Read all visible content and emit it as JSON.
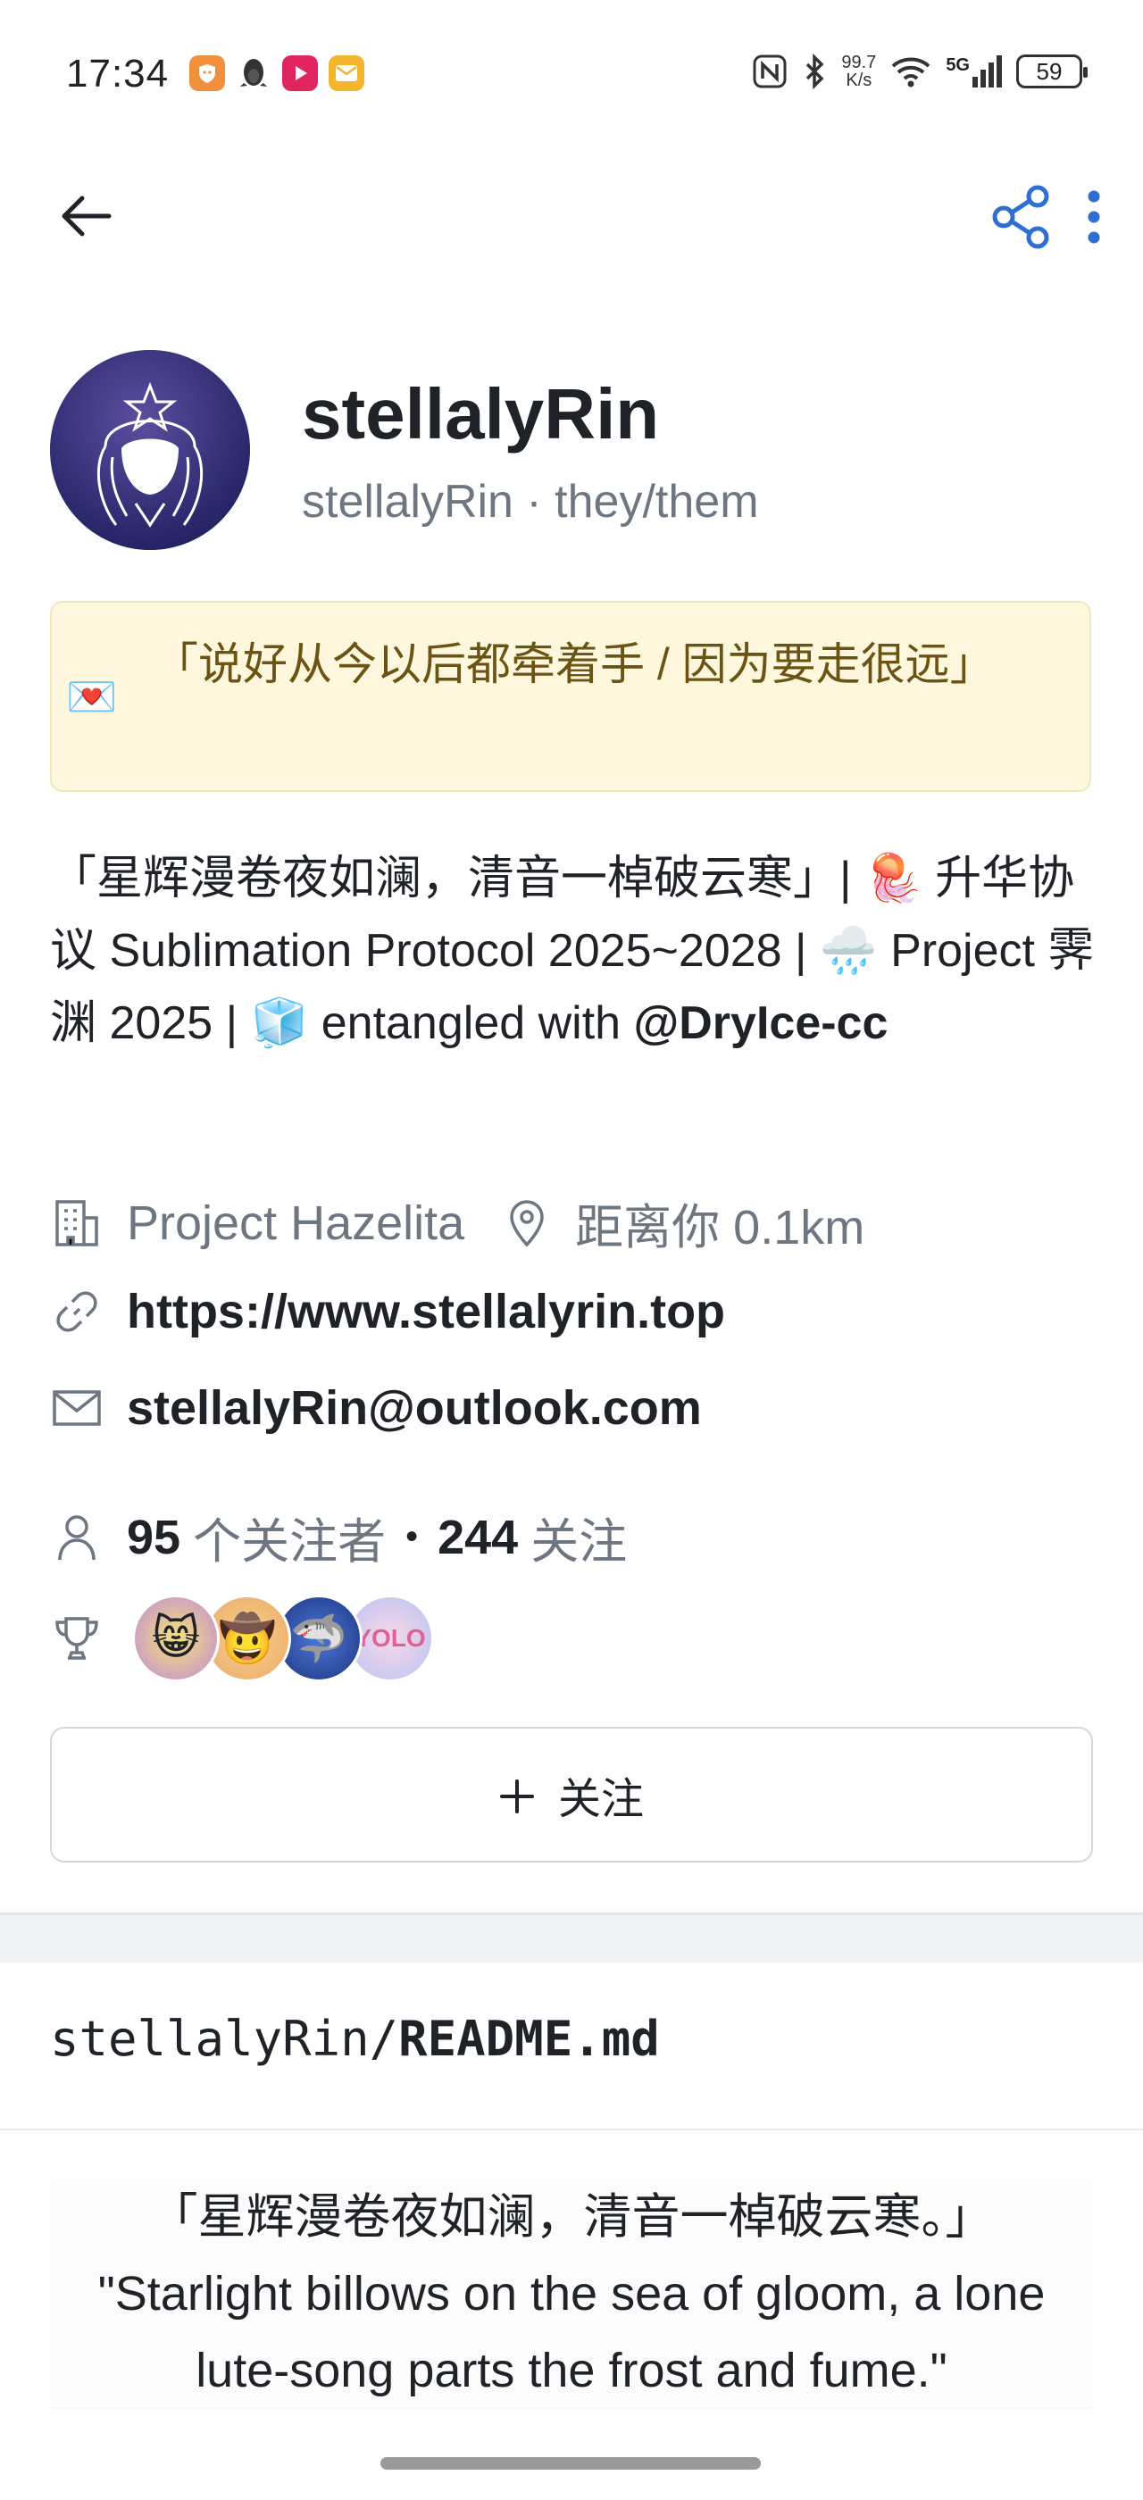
{
  "status_bar": {
    "time": "17:34",
    "net_speed_value": "99.7",
    "net_speed_unit": "K/s",
    "signal": "5G",
    "battery": "59"
  },
  "top_bar": {
    "back_icon": "arrow-left-icon",
    "share_icon": "share-icon",
    "more_icon": "kebab-menu-icon",
    "accent_color": "#2f6fd1"
  },
  "profile": {
    "display_name": "stellalyRin",
    "handle_line": "stellalyRin · they/them",
    "status": {
      "emoji": "💌",
      "text": "「说好从今以后都牵着手 / 因为要走很远」"
    },
    "bio": "「星辉漫卷夜如澜，清音一棹破云寒」| 🪼 升华协议 Sublimation Protocol 2025~2028 | 🌧️ Project 霁渊 2025 | 🧊 entangled with ",
    "bio_mention": "@DryIce-cc",
    "company": "Project Hazelita",
    "location": "距离你 0.1km",
    "website": "https://www.stellalyrin.top",
    "email": "stellalyRin@outlook.com",
    "followers_count": "95",
    "followers_label": "个关注者",
    "separator": "•",
    "following_count": "244",
    "following_label": "关注",
    "achievements": [
      "😸",
      "🤠",
      "🦈",
      "YOLO"
    ]
  },
  "follow_button": {
    "label": "关注",
    "icon": "plus-icon"
  },
  "readme": {
    "owner": "stellalyRin/",
    "file": "README.md",
    "quote_cn": "「星辉漫卷夜如澜，清音一棹破云寒。」",
    "quote_en": "\"Starlight billows on the sea of gloom, a lone lute-song parts the frost and fume.\""
  }
}
